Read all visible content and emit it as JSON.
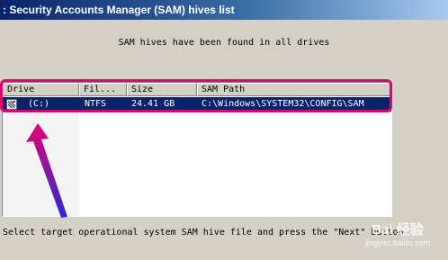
{
  "window": {
    "title": ": Security Accounts Manager (SAM) hives list"
  },
  "info": {
    "message": "SAM hives have been found in all drives"
  },
  "list": {
    "columns": [
      "Drive",
      "Fil...",
      "Size",
      "SAM Path"
    ],
    "rows": [
      {
        "drive": "(C:)",
        "filesystem": "NTFS",
        "size": "24.41 GB",
        "sam_path": "C:\\Windows\\SYSTEM32\\CONFIG\\SAM",
        "selected": true
      }
    ]
  },
  "instruction": {
    "text": "Select target operational system SAM hive file and press the \"Next\" button."
  },
  "watermark": {
    "main": "Bai 经验",
    "sub": "jingyan.baidu.com"
  },
  "colors": {
    "selection": "#0a246a",
    "annotation_box": "#e6006e",
    "arrow_gradient": [
      "#e6006e",
      "#2a2ad8"
    ]
  }
}
